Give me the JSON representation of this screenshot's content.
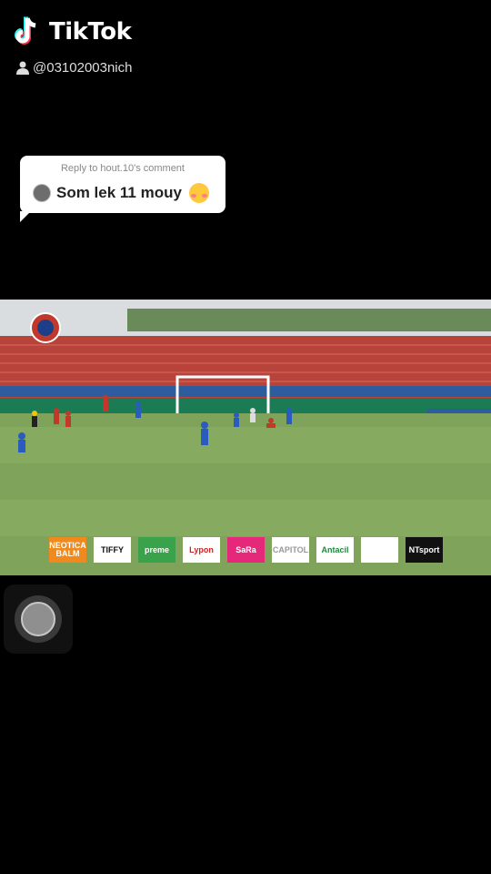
{
  "app": {
    "name": "TikTok"
  },
  "user": {
    "handle": "@03102003nich"
  },
  "reply": {
    "title": "Reply to hout.10's comment",
    "text": "Som lek 11 mouy"
  },
  "sponsors": [
    {
      "label": "NEOTICA BALM",
      "bg": "#f08a1e",
      "fg": "#ffffff"
    },
    {
      "label": "TIFFY",
      "bg": "#ffffff",
      "fg": "#111111"
    },
    {
      "label": "preme",
      "bg": "#3aa24a",
      "fg": "#ffffff"
    },
    {
      "label": "Lypon",
      "bg": "#ffffff",
      "fg": "#d42020"
    },
    {
      "label": "SaRa",
      "bg": "#e6287a",
      "fg": "#ffffff"
    },
    {
      "label": "CAPITOL",
      "bg": "#ffffff",
      "fg": "#999999"
    },
    {
      "label": "Antacil",
      "bg": "#ffffff",
      "fg": "#1d8a3c"
    },
    {
      "label": "",
      "bg": "#ffffff",
      "fg": "#e6287a"
    },
    {
      "label": "NTsport",
      "bg": "#111111",
      "fg": "#ffffff"
    }
  ],
  "colors": {
    "background": "#000000",
    "pitch": "#7fa35a",
    "stand": "#c0392b"
  }
}
